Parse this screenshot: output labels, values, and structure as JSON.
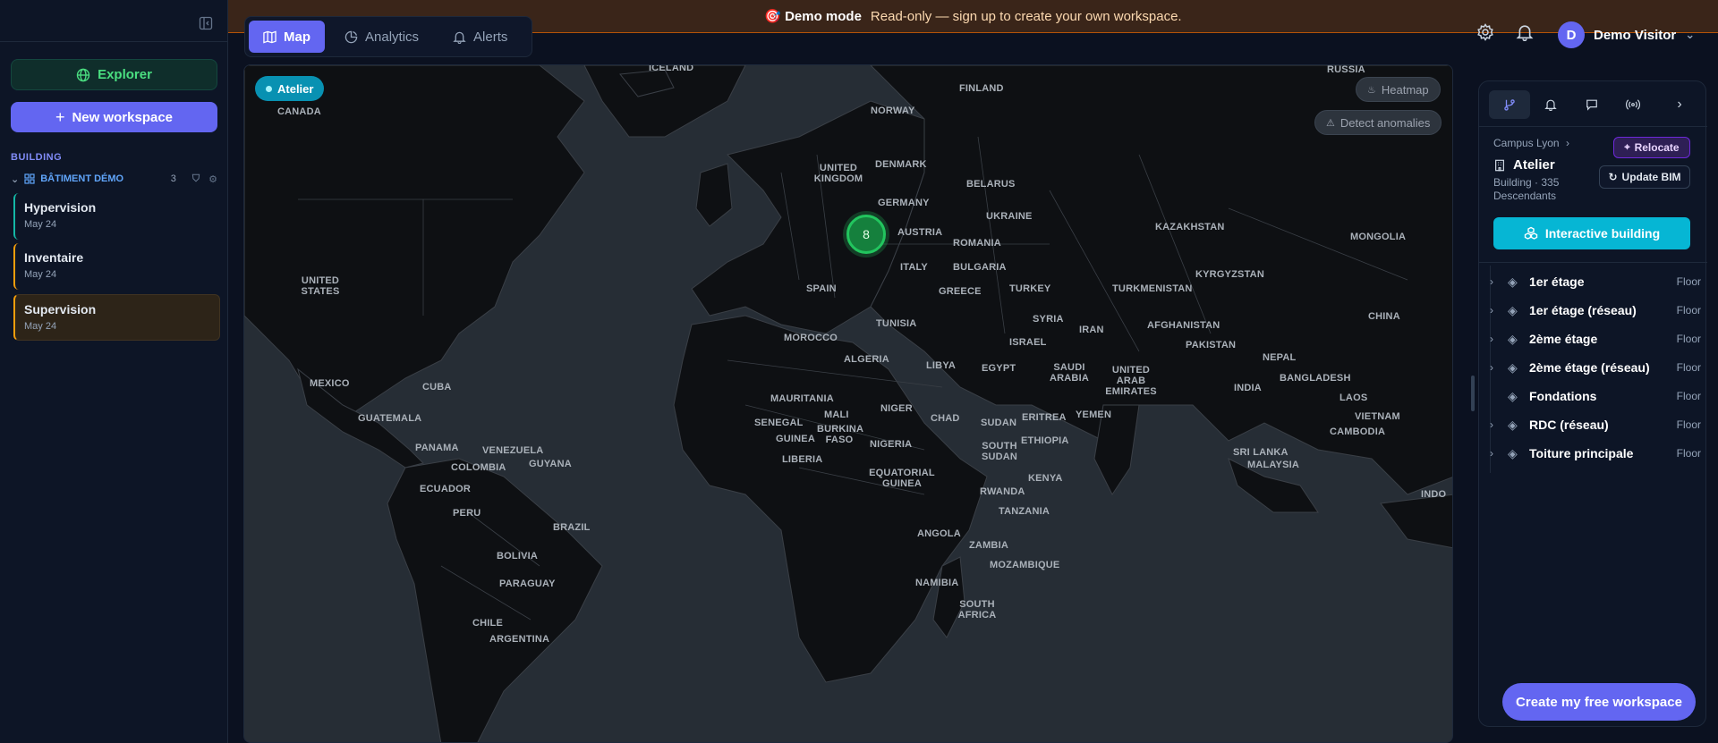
{
  "banner": {
    "icon": "🎯",
    "title": "Demo mode",
    "text": "Read-only — sign up to create your own workspace."
  },
  "sidebar": {
    "explorer_label": "Explorer",
    "new_workspace_label": "New workspace",
    "section_label": "BUILDING",
    "building_name": "BÂTIMENT DÉMO",
    "building_count": "3",
    "items": [
      {
        "title": "Hypervision",
        "date": "May 24"
      },
      {
        "title": "Inventaire",
        "date": "May 24"
      },
      {
        "title": "Supervision",
        "date": "May 24"
      }
    ]
  },
  "tabs": [
    {
      "label": "Map"
    },
    {
      "label": "Analytics"
    },
    {
      "label": "Alerts"
    }
  ],
  "user": {
    "initial": "D",
    "name": "Demo Visitor"
  },
  "map": {
    "chip_label": "Atelier",
    "heatmap_label": "Heatmap",
    "anomalies_label": "Detect anomalies",
    "cluster_count": "8",
    "labels": [
      "ICELAND",
      "RUSSIA",
      "FINLAND",
      "CANADA",
      "NORWAY",
      "UNITED KINGDOM",
      "DENMARK",
      "BELARUS",
      "GERMANY",
      "UKRAINE",
      "KAZAKHSTAN",
      "MONGOLIA",
      "AUSTRIA",
      "ROMANIA",
      "ITALY",
      "BULGARIA",
      "KYRGYZSTAN",
      "UNITED STATES",
      "SPAIN",
      "GREECE",
      "TURKEY",
      "TURKMENISTAN",
      "CHINA",
      "SYRIA",
      "AFGHANISTAN",
      "TUNISIA",
      "IRAN",
      "ISRAEL",
      "PAKISTAN",
      "NEPAL",
      "MOROCCO",
      "ALGERIA",
      "LIBYA",
      "EGYPT",
      "SAUDI ARABIA",
      "UNITED ARAB EMIRATES",
      "BANGLADESH",
      "MEXICO",
      "CUBA",
      "INDIA",
      "LAOS",
      "MAURITANIA",
      "NIGER",
      "YEMEN",
      "VIETNAM",
      "MALI",
      "CHAD",
      "SUDAN",
      "ERITREA",
      "GUATEMALA",
      "SENEGAL",
      "BURKINA FASO",
      "CAMBODIA",
      "GUINEA",
      "NIGERIA",
      "ETHIOPIA",
      "SOUTH SUDAN",
      "PANAMA",
      "VENEZUELA",
      "SRI LANKA",
      "GUYANA",
      "COLOMBIA",
      "LIBERIA",
      "MALAYSIA",
      "EQUATORIAL GUINEA",
      "KENYA",
      "ECUADOR",
      "RWANDA",
      "INDO",
      "PERU",
      "TANZANIA",
      "BRAZIL",
      "ANGOLA",
      "ZAMBIA",
      "BOLIVIA",
      "MOZAMBIQUE",
      "PARAGUAY",
      "NAMIBIA",
      "SOUTH AFRICA",
      "CHILE",
      "ARGENTINA"
    ]
  },
  "panel": {
    "breadcrumb": "Campus Lyon",
    "title": "Atelier",
    "subtitle": "Building · 335 Descendants",
    "relocate_label": "Relocate",
    "update_bim_label": "Update BIM",
    "interactive_label": "Interactive building",
    "floors": [
      {
        "name": "1er étage",
        "type": "Floor",
        "expandable": true
      },
      {
        "name": "1er étage (réseau)",
        "type": "Floor",
        "expandable": true
      },
      {
        "name": "2ème étage",
        "type": "Floor",
        "expandable": true
      },
      {
        "name": "2ème étage (réseau)",
        "type": "Floor",
        "expandable": true
      },
      {
        "name": "Fondations",
        "type": "Floor",
        "expandable": false
      },
      {
        "name": "RDC (réseau)",
        "type": "Floor",
        "expandable": true
      },
      {
        "name": "Toiture principale",
        "type": "Floor",
        "expandable": true
      }
    ]
  },
  "cta": {
    "label": "Create my free workspace"
  },
  "colors": {
    "accent": "#6366f1",
    "cyan": "#06b6d4",
    "green": "#22c55e",
    "banner": "#3a2519"
  }
}
